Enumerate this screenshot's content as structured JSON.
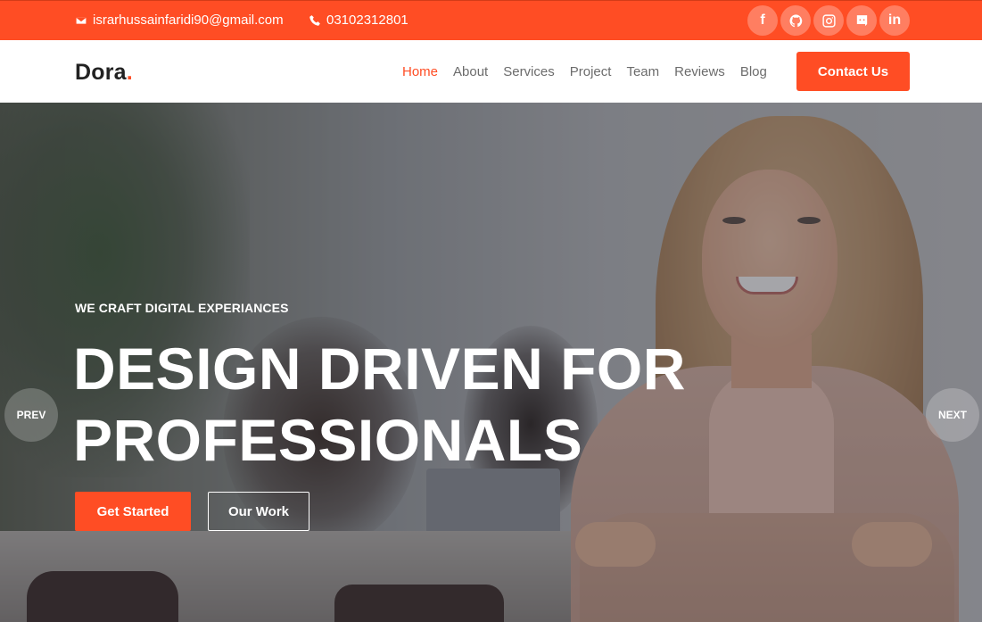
{
  "topbar": {
    "email": "israrhussainfaridi90@gmail.com",
    "phone": "03102312801",
    "socials": [
      {
        "icon": "facebook-icon",
        "glyph": "f"
      },
      {
        "icon": "github-icon",
        "glyph": ""
      },
      {
        "icon": "instagram-icon",
        "glyph": ""
      },
      {
        "icon": "discord-icon",
        "glyph": ""
      },
      {
        "icon": "linkedin-icon",
        "glyph": "in"
      }
    ]
  },
  "nav": {
    "logo_text": "Dora",
    "logo_dot": ".",
    "items": [
      {
        "label": "Home",
        "active": true
      },
      {
        "label": "About"
      },
      {
        "label": "Services"
      },
      {
        "label": "Project"
      },
      {
        "label": "Team"
      },
      {
        "label": "Reviews"
      },
      {
        "label": "Blog"
      }
    ],
    "cta": "Contact Us"
  },
  "hero": {
    "kicker": "WE CRAFT DIGITAL EXPERIANCES",
    "headline_line1": "DESIGN DRIVEN FOR",
    "headline_line2": "PROFESSIONALS",
    "primary_button": "Get Started",
    "secondary_button": "Our Work",
    "prev": "PREV",
    "next": "NEXT"
  },
  "colors": {
    "accent": "#ff4d24",
    "text_dark": "#222222",
    "nav_text": "#6c6c6c"
  }
}
